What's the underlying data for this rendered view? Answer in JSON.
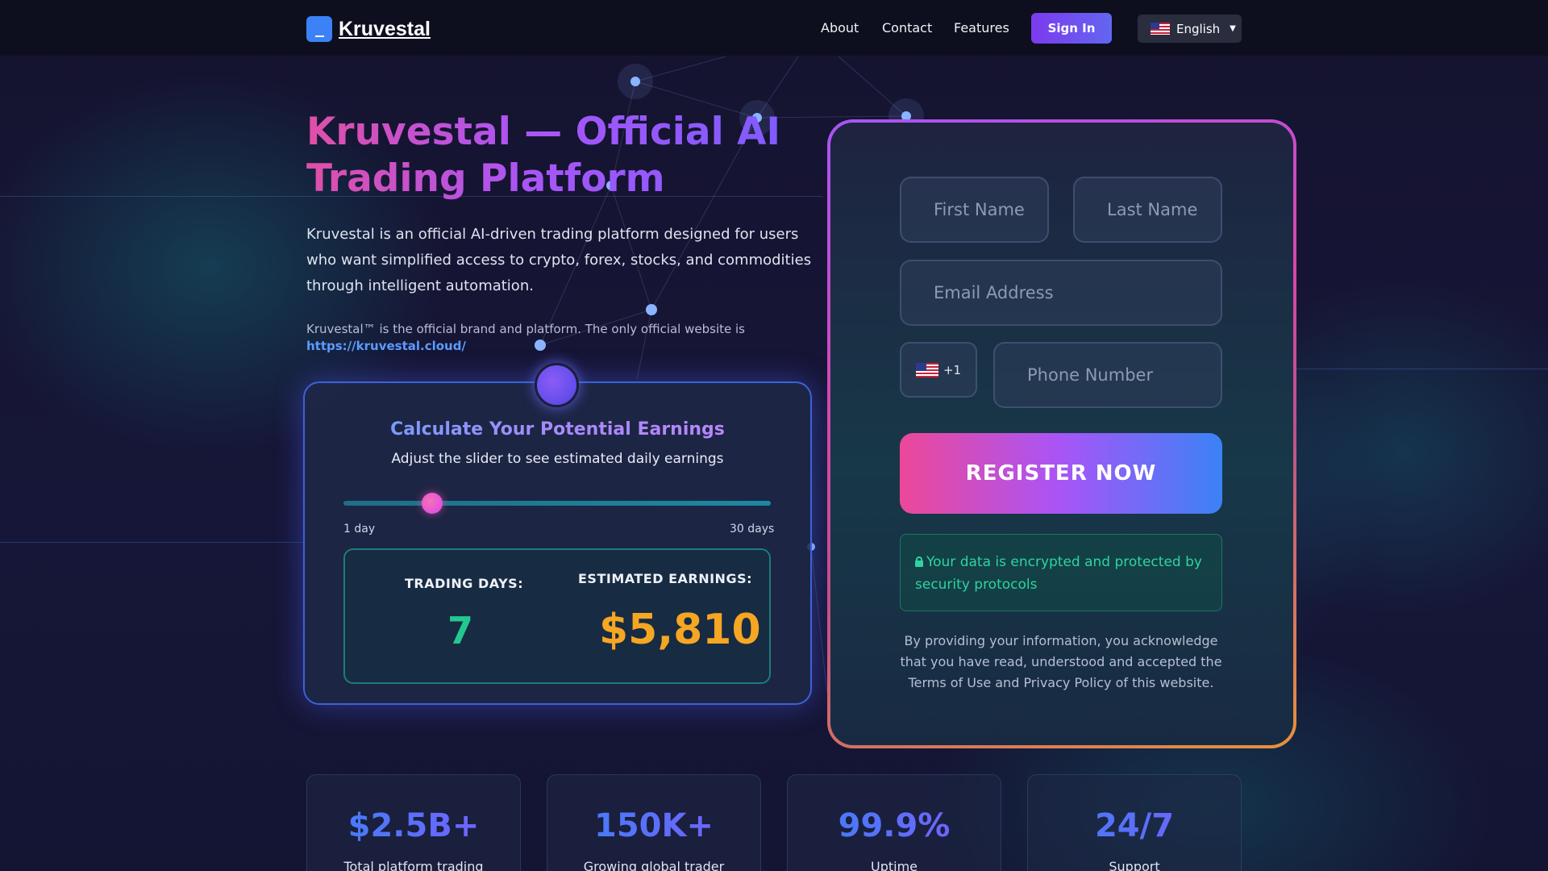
{
  "header": {
    "brand": "Kruvestal",
    "nav": [
      "About",
      "Contact",
      "Features"
    ],
    "signin_label": "Sign In",
    "language": "English"
  },
  "hero": {
    "title": "Kruvestal — Official AI Trading Platform",
    "description": "Kruvestal is an official AI-driven trading platform designed for users who want simplified access to crypto, forex, stocks, and commodities through intelligent automation.",
    "note": "Kruvestal™ is the official brand and platform. The only official website is",
    "link": "https://kruvestal.cloud/"
  },
  "calculator": {
    "title": "Calculate Your Potential Earnings",
    "subtitle": "Adjust the slider to see estimated daily earnings",
    "slider_min_label": "1 day",
    "slider_max_label": "30 days",
    "slider_min": 1,
    "slider_max": 30,
    "slider_value": 7,
    "days_label": "TRADING DAYS:",
    "days_value": "7",
    "earnings_label": "ESTIMATED EARNINGS:",
    "earnings_value": "$5,810"
  },
  "form": {
    "first_name_placeholder": "First Name",
    "last_name_placeholder": "Last Name",
    "email_placeholder": "Email Address",
    "country_code": "+1",
    "phone_placeholder": "Phone Number",
    "register_label": "REGISTER NOW",
    "secure_text": "Your data is encrypted and protected by security protocols",
    "consent_text": "By providing your information, you acknowledge that you have read, understood and accepted the Terms of Use and Privacy Policy of this website."
  },
  "stats": [
    {
      "value": "$2.5B+",
      "label": "Total platform trading"
    },
    {
      "value": "150K+",
      "label": "Growing global trader"
    },
    {
      "value": "99.9%",
      "label": "Uptime"
    },
    {
      "value": "24/7",
      "label": "Support"
    }
  ],
  "colors": {
    "accent_purple": "#7c3aed",
    "accent_pink": "#ec4899",
    "accent_blue": "#3b82f6",
    "success_green": "#22c98e",
    "earnings_orange": "#f5a623"
  }
}
